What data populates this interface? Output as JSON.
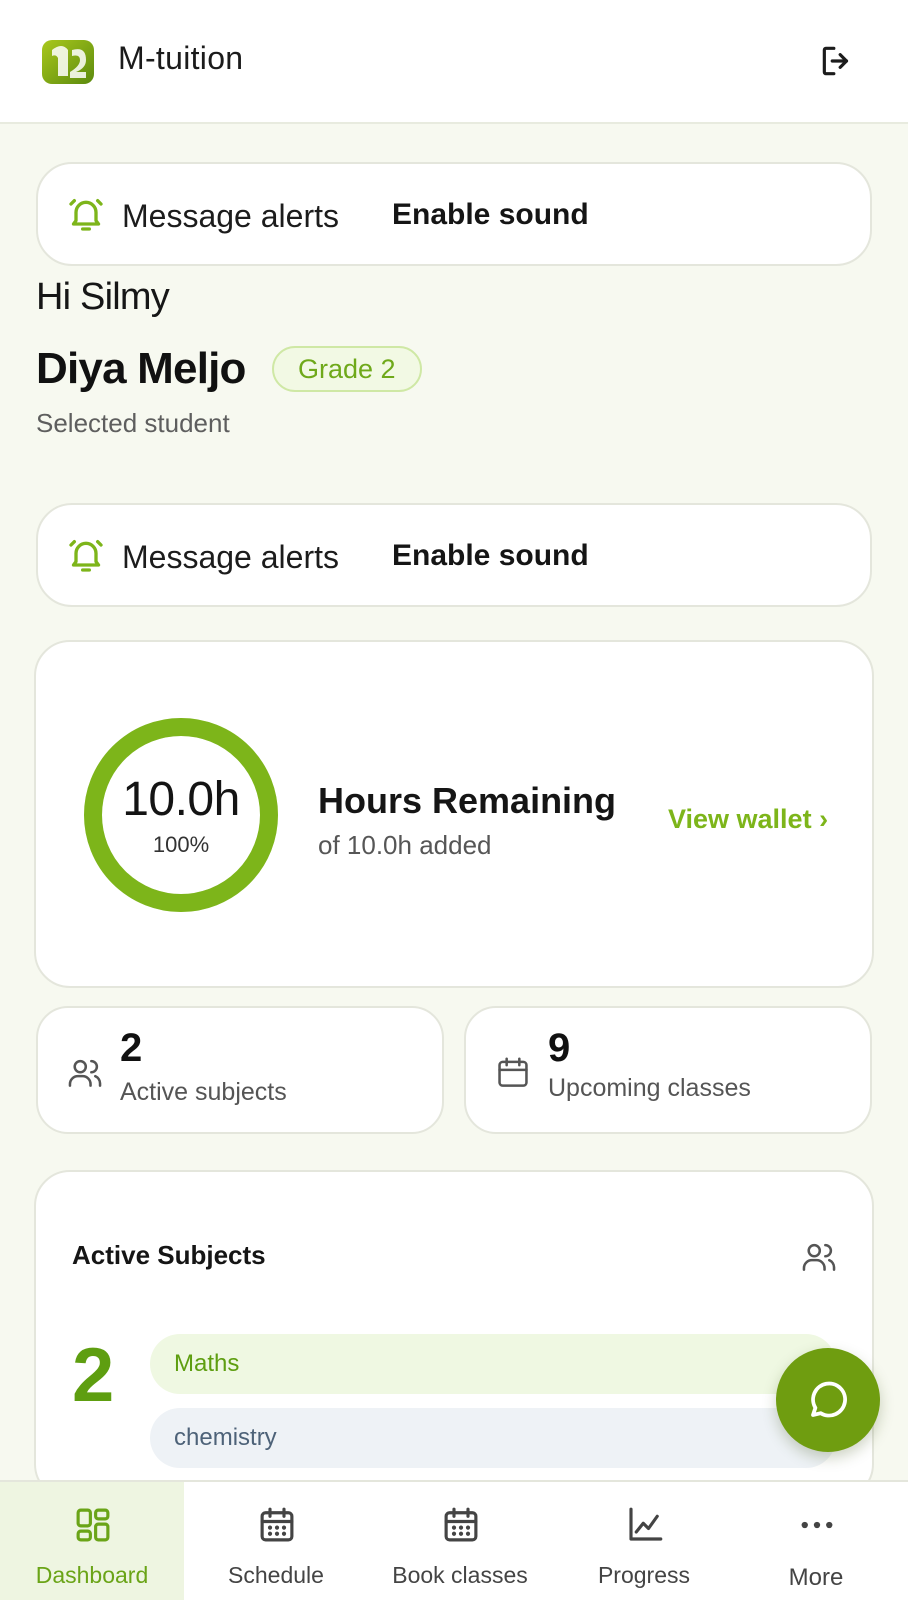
{
  "header": {
    "app_title": "M-tuition",
    "logo_icon": "m-tuition-logo",
    "logout_icon": "logout-icon"
  },
  "alerts": [
    {
      "label": "Message alerts",
      "action": "Enable sound"
    },
    {
      "label": "Message alerts",
      "action": "Enable sound"
    }
  ],
  "student": {
    "greeting": "Hi Silmy",
    "name": "Diya Meljo",
    "grade": "Grade 2",
    "selected_label": "Selected student"
  },
  "hours": {
    "value": "10.0h",
    "percent_text": "100%",
    "fraction": 1.0,
    "title": "Hours Remaining",
    "subtitle": "of 10.0h added",
    "wallet_link": "View wallet ›"
  },
  "stats": [
    {
      "icon": "users-icon",
      "value": "2",
      "label": "Active subjects"
    },
    {
      "icon": "calendar-icon",
      "value": "9",
      "label": "Upcoming classes"
    }
  ],
  "subjects": {
    "title": "Active Subjects",
    "count": "2",
    "items": [
      "Maths",
      "chemistry"
    ]
  },
  "nav": [
    {
      "label": "Dashboard",
      "icon": "dashboard-grid-icon",
      "active": true
    },
    {
      "label": "Schedule",
      "icon": "calendar-icon",
      "active": false
    },
    {
      "label": "Book classes",
      "icon": "calendar-icon",
      "active": false
    },
    {
      "label": "Progress",
      "icon": "chart-line-icon",
      "active": false
    },
    {
      "label": "More",
      "icon": "more-dots-icon",
      "active": false
    }
  ],
  "colors": {
    "accent": "#7db51a",
    "accent_dark": "#6f9d10",
    "background": "#f7f9f0"
  }
}
